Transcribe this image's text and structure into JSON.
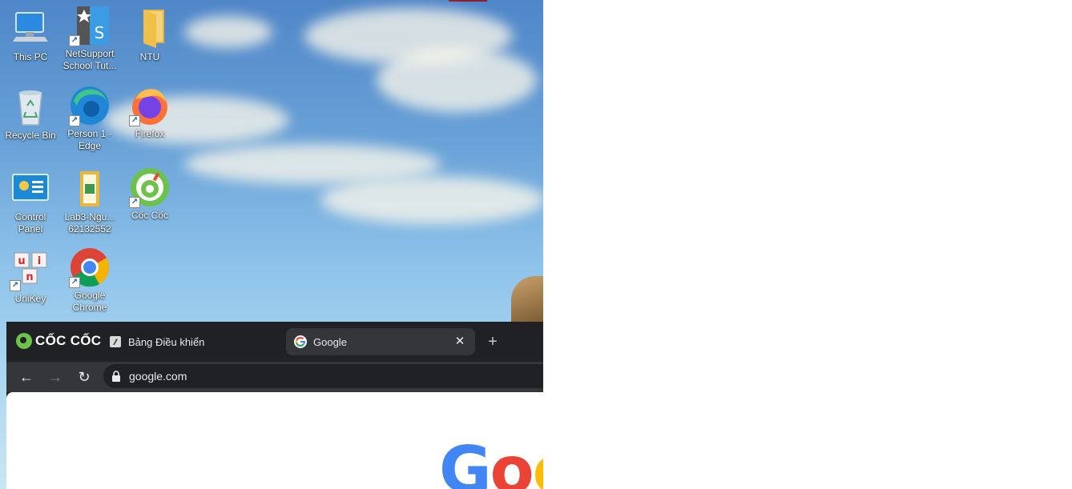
{
  "desktop": {
    "icons": [
      {
        "label": "This PC",
        "icon": "this-pc-icon"
      },
      {
        "label": "NetSupport School Tut...",
        "icon": "netsupport-icon"
      },
      {
        "label": "NTU",
        "icon": "folder-icon"
      },
      {
        "label": "Recycle Bin",
        "icon": "recycle-bin-icon"
      },
      {
        "label": "Person 1 - Edge",
        "icon": "edge-icon"
      },
      {
        "label": "Firefox",
        "icon": "firefox-icon"
      },
      {
        "label": "Control Panel",
        "icon": "control-panel-icon"
      },
      {
        "label": "Lab3-Ngu... 62132552",
        "icon": "document-folder-icon"
      },
      {
        "label": "Cốc Cốc",
        "icon": "coccoc-icon"
      },
      {
        "label": "UniKey",
        "icon": "unikey-icon"
      },
      {
        "label": "Google Chrome",
        "icon": "chrome-icon"
      }
    ]
  },
  "browser": {
    "brand": "CỐC CỐC",
    "tabs": [
      {
        "title": "Bảng Điều khiển",
        "active": false
      },
      {
        "title": "Google",
        "active": true
      }
    ],
    "address": "google.com",
    "page_logo": "Goo"
  },
  "colors": {
    "google_blue": "#4285f4",
    "google_red": "#ea4335",
    "google_yellow": "#fbbc05",
    "coccoc_green": "#6cc24a"
  }
}
